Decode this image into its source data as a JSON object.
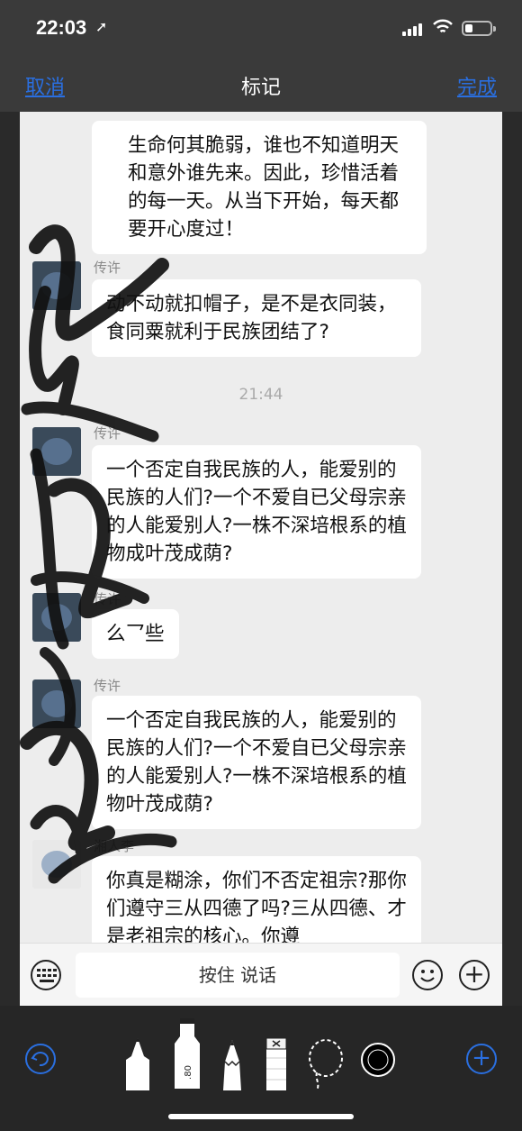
{
  "status_bar": {
    "time": "22:03",
    "location_icon": "location-arrow-icon"
  },
  "navbar": {
    "cancel": "取消",
    "title": "标记",
    "done": "完成"
  },
  "messages": [
    {
      "text": "生命何其脆弱，谁也不知道明天和意外谁先来。因此，珍惜活着的每一天。从当下开始，每天都要开心度过！"
    },
    {
      "sender": "传许",
      "text": "动不动就扣帽子，是不是衣同装，食同粟就利于民族团结了?"
    },
    {
      "sender": "传许",
      "text": "一个否定自我民族的人，能爱别的民族的人们?一个不爱自已父母宗亲的人能爱别人?一株不深培根系的植物成叶茂成荫?"
    },
    {
      "sender": "传许",
      "text": "么乛些"
    },
    {
      "sender": "传许",
      "text": "一个否定自我民族的人，能爱别的民族的人们?一个不爱自已父母宗亲的人能爱别人?一株不深培根系的植物叶茂成荫?"
    },
    {
      "sender": "湘人李",
      "text": "你真是糊涂，你们不否定祖宗?那你们遵守三从四德了吗?三从四德、才是老祖宗的核心。你遵"
    }
  ],
  "timestamp": "21:44",
  "input_bar": {
    "hold_to_talk": "按住 说话"
  },
  "toolbar": {
    "tools": [
      "pen-tool-icon",
      "marker-tool-icon",
      "pencil-tool-icon",
      "eraser-tool-icon",
      "lasso-tool-icon",
      "color-picker-icon"
    ],
    "marker_label": ".80"
  },
  "colors": {
    "accent": "#2a6fe0",
    "chat_bg": "#ededed",
    "bubble": "#ffffff",
    "bar_bg": "#3a3a3a"
  }
}
